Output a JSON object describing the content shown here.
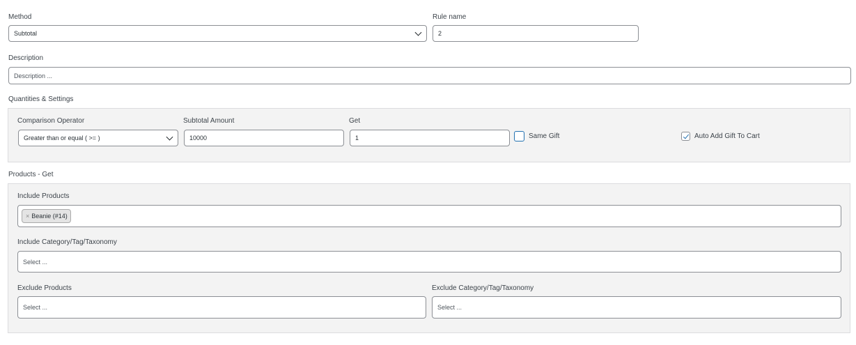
{
  "method": {
    "label": "Method",
    "value": "Subtotal"
  },
  "rule_name": {
    "label": "Rule name",
    "value": "2"
  },
  "description": {
    "label": "Description",
    "placeholder": "Description ..."
  },
  "quantities": {
    "section_label": "Quantities & Settings",
    "comparison_operator": {
      "label": "Comparison Operator",
      "value": "Greater than or equal ( >= )"
    },
    "subtotal_amount": {
      "label": "Subtotal Amount",
      "value": "10000"
    },
    "get": {
      "label": "Get",
      "value": "1"
    },
    "same_gift": {
      "label": "Same Gift",
      "checked": false
    },
    "auto_add": {
      "label": "Auto Add Gift To Cart",
      "checked": true
    }
  },
  "products_get": {
    "section_label": "Products - Get",
    "include_products": {
      "label": "Include Products",
      "tags": [
        "Beanie (#14)"
      ],
      "tag_remove": "×"
    },
    "include_category": {
      "label": "Include Category/Tag/Taxonomy",
      "placeholder": "Select ..."
    },
    "exclude_products": {
      "label": "Exclude Products",
      "placeholder": "Select ..."
    },
    "exclude_category": {
      "label": "Exclude Category/Tag/Taxonomy",
      "placeholder": "Select ..."
    }
  },
  "colors": {
    "accent": "#2271b1",
    "panel_bg": "#f3f3f3",
    "border": "#8c8f94"
  }
}
